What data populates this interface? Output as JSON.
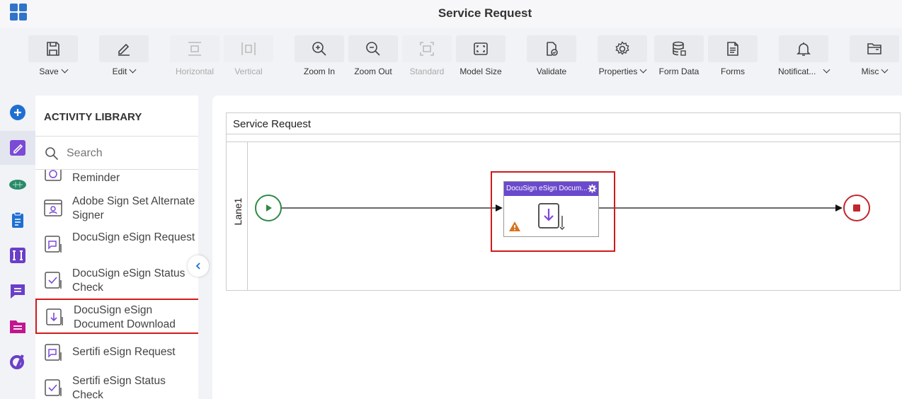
{
  "app": {
    "title": "Service Request"
  },
  "toolbar": {
    "save": "Save",
    "edit": "Edit",
    "horizontal": "Horizontal",
    "vertical": "Vertical",
    "zoom_in": "Zoom In",
    "zoom_out": "Zoom Out",
    "standard": "Standard",
    "model_size": "Model Size",
    "validate": "Validate",
    "properties": "Properties",
    "form_data": "Form Data",
    "forms": "Forms",
    "notifications": "Notificat...",
    "misc": "Misc"
  },
  "library": {
    "title": "ACTIVITY LIBRARY",
    "search_placeholder": "Search",
    "items": [
      {
        "label": "Reminder"
      },
      {
        "label": "Adobe Sign Set Alternate Signer"
      },
      {
        "label": "DocuSign eSign Request"
      },
      {
        "label": "DocuSign eSign Status Check"
      },
      {
        "label": "DocuSign eSign Document Download"
      },
      {
        "label": "Sertifi eSign Request"
      },
      {
        "label": "Sertifi eSign Status Check"
      }
    ]
  },
  "canvas": {
    "pool_title": "Service Request",
    "lane_label": "Lane1",
    "task_title": "DocuSign eSign Docum..."
  },
  "colors": {
    "accent": "#2f74c9",
    "task_header": "#6a49cc",
    "selection": "#d11a1a",
    "start": "#2e8a47",
    "end": "#c0282d",
    "warning": "#d9731e"
  }
}
